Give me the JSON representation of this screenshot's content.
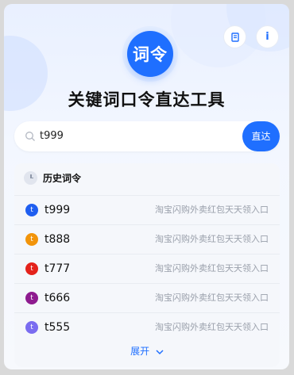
{
  "header": {
    "logo_text": "词令",
    "title": "关键词口令直达工具",
    "bookmark_icon": "bookmark-icon",
    "info_label": "i"
  },
  "search": {
    "value": "t999",
    "button_label": "直达",
    "icon": "search-icon"
  },
  "history": {
    "title": "历史词令",
    "icon": "clock-icon",
    "items": [
      {
        "badge": "t",
        "code": "t999",
        "desc": "淘宝闪购外卖红包天天领入口",
        "color": "#1f5ef0"
      },
      {
        "badge": "t",
        "code": "t888",
        "desc": "淘宝闪购外卖红包天天领入口",
        "color": "#f2940a"
      },
      {
        "badge": "t",
        "code": "t777",
        "desc": "淘宝闪购外卖红包天天领入口",
        "color": "#e4221b"
      },
      {
        "badge": "t",
        "code": "t666",
        "desc": "淘宝闪购外卖红包天天领入口",
        "color": "#8e1b8f"
      },
      {
        "badge": "t",
        "code": "t555",
        "desc": "淘宝闪购外卖红包天天领入口",
        "color": "#7a6cf0"
      }
    ],
    "expand_label": "展开"
  },
  "colors": {
    "accent": "#1f6fff"
  }
}
